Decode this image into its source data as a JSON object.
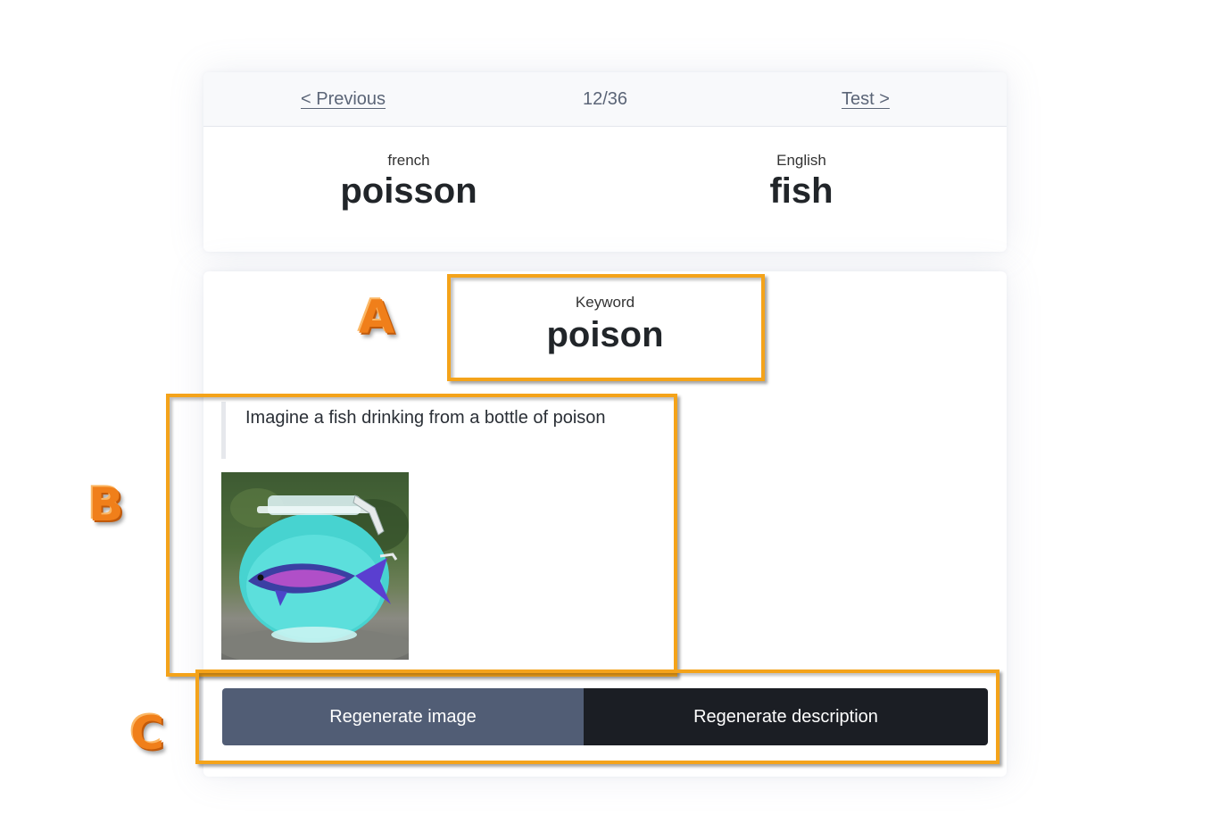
{
  "nav": {
    "previous_label": "< Previous",
    "counter": "12/36",
    "next_label": "Test >"
  },
  "words": {
    "source_language": "french",
    "source_word": "poisson",
    "target_language": "English",
    "target_word": "fish"
  },
  "keyword": {
    "label": "Keyword",
    "word": "poison"
  },
  "description": "Imagine a fish drinking from a bottle of poison",
  "buttons": {
    "regenerate_image": "Regenerate image",
    "regenerate_description": "Regenerate description"
  },
  "annotations": {
    "a": "A",
    "b": "B",
    "c": "C"
  },
  "colors": {
    "highlight": "#f4a31a",
    "marker": "#f07f1a",
    "button_image_bg": "#515d75",
    "button_description_bg": "#1b1e24"
  }
}
